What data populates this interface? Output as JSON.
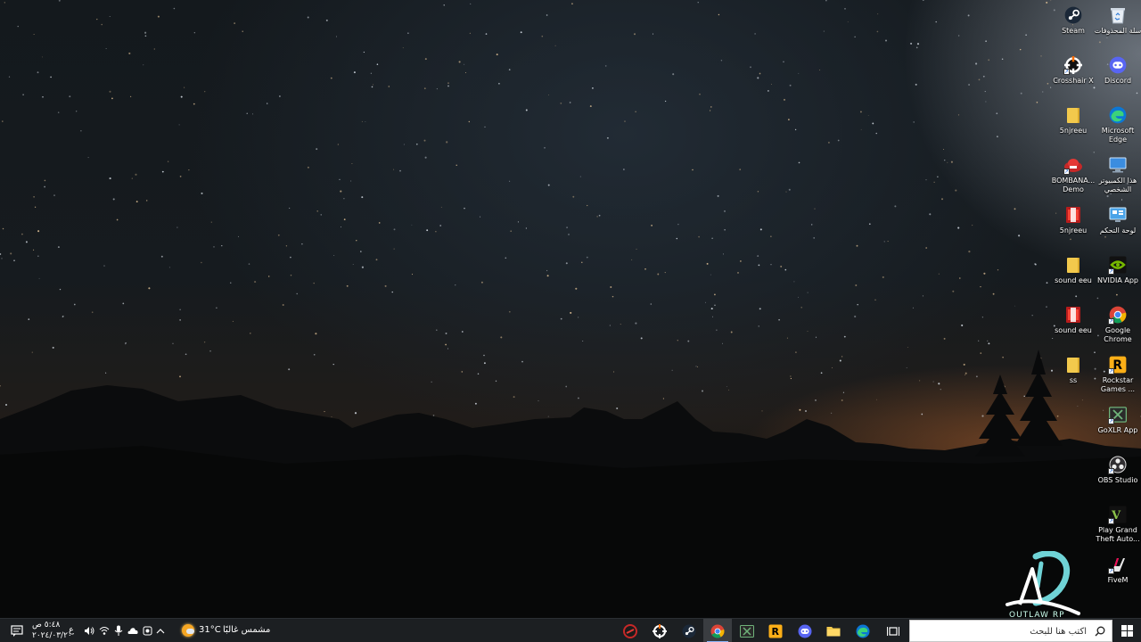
{
  "desktop": {
    "icons": [
      {
        "name": "steam",
        "label": "Steam",
        "icon": "steam-icon"
      },
      {
        "name": "recycle-bin",
        "label": "سلة المحذوفات",
        "icon": "recycle-bin-icon"
      },
      {
        "name": "crosshair-x",
        "label": "Crosshair X",
        "icon": "crosshair-icon"
      },
      {
        "name": "discord",
        "label": "Discord",
        "icon": "discord-icon"
      },
      {
        "name": "5njreeu-folder",
        "label": "5njreeu",
        "icon": "folder-icon"
      },
      {
        "name": "microsoft-edge",
        "label": "Microsoft Edge",
        "icon": "edge-icon"
      },
      {
        "name": "bombana-demo",
        "label": "BOMBANA... Demo",
        "icon": "bombana-icon"
      },
      {
        "name": "this-pc",
        "label": "هذا الكمبيوتر الشخصي",
        "icon": "computer-icon"
      },
      {
        "name": "5njreeu-winrar",
        "label": "5njreeu",
        "icon": "winrar-icon"
      },
      {
        "name": "control-panel",
        "label": "لوحة التحكم",
        "icon": "control-panel-icon"
      },
      {
        "name": "sound-eeu-folder",
        "label": "sound eeu",
        "icon": "folder-icon"
      },
      {
        "name": "nvidia-app",
        "label": "NVIDIA App",
        "icon": "nvidia-icon"
      },
      {
        "name": "sound-eeu-winrar",
        "label": "sound eeu",
        "icon": "winrar-icon"
      },
      {
        "name": "google-chrome",
        "label": "Google Chrome",
        "icon": "chrome-icon"
      },
      {
        "name": "ss-folder",
        "label": "ss",
        "icon": "folder-icon"
      },
      {
        "name": "rockstar-games",
        "label": "Rockstar Games ...",
        "icon": "rockstar-icon"
      },
      {
        "name": "goxlr-app",
        "label": "GoXLR App",
        "icon": "goxlr-icon"
      },
      {
        "name": "obs-studio",
        "label": "OBS Studio",
        "icon": "obs-icon"
      },
      {
        "name": "play-gta",
        "label": "Play Grand Theft Auto...",
        "icon": "gta-icon"
      },
      {
        "name": "fivem",
        "label": "FiveM",
        "icon": "fivem-icon"
      }
    ],
    "watermark_text": "OUTLAW RP"
  },
  "taskbar": {
    "search_placeholder": "اكتب هنا للبحث",
    "pinned_apps": [
      {
        "name": "taskbar-bombana",
        "icon": "bombana-icon"
      },
      {
        "name": "taskbar-crosshair",
        "icon": "crosshair-icon"
      },
      {
        "name": "taskbar-steam",
        "icon": "steam-icon"
      },
      {
        "name": "taskbar-chrome",
        "icon": "chrome-icon"
      },
      {
        "name": "taskbar-goxlr",
        "icon": "goxlr-icon"
      },
      {
        "name": "taskbar-rockstar",
        "icon": "rockstar-icon"
      },
      {
        "name": "taskbar-discord",
        "icon": "discord-icon"
      },
      {
        "name": "taskbar-file-explorer",
        "icon": "folder-icon"
      },
      {
        "name": "taskbar-edge",
        "icon": "edge-icon"
      },
      {
        "name": "taskbar-task-view",
        "icon": "task-view-icon"
      }
    ],
    "weather": {
      "temperature": "31°C",
      "condition": "مشمس غالبًا"
    },
    "language": "ع",
    "clock": {
      "time": "٥:٤٨ ص",
      "date": "٢٠٢٤/٠٣/٢٠"
    }
  },
  "colors": {
    "taskbar_bg": "#1c1f22",
    "accent": "#8ab4f8",
    "watermark": "#6fd3d6"
  }
}
